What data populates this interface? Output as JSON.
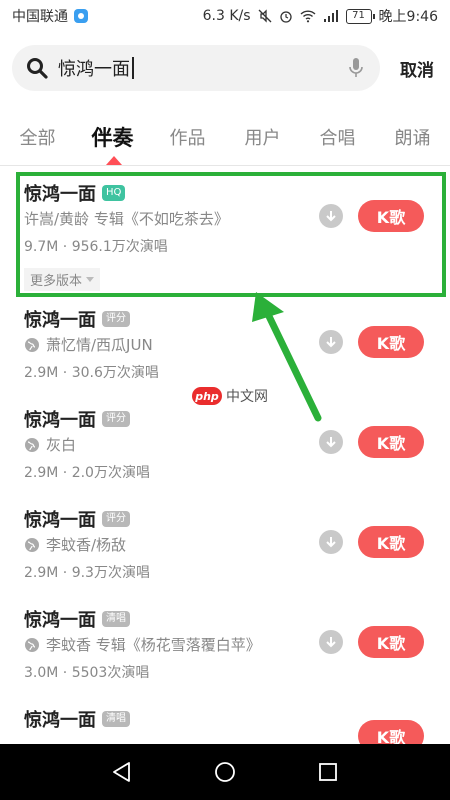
{
  "status_bar": {
    "carrier": "中国联通",
    "speed": "6.3 K/s",
    "battery": "71",
    "time": "晚上9:46"
  },
  "search": {
    "query": "惊鸿一面",
    "cancel_label": "取消"
  },
  "tabs": [
    {
      "label": "全部",
      "active": false
    },
    {
      "label": "伴奏",
      "active": true
    },
    {
      "label": "作品",
      "active": false
    },
    {
      "label": "用户",
      "active": false
    },
    {
      "label": "合唱",
      "active": false
    },
    {
      "label": "朗诵",
      "active": false
    }
  ],
  "results": [
    {
      "title": "惊鸿一面",
      "badge": "HQ",
      "subtitle": "许嵩/黄龄 专辑《不如吃茶去》",
      "meta": "9.7M · 956.1万次演唱",
      "more": "更多版本",
      "action": "K歌"
    },
    {
      "title": "惊鸿一面",
      "badge": "评分",
      "subtitle": "萧忆情/西瓜JUN",
      "meta": "2.9M · 30.6万次演唱",
      "action": "K歌"
    },
    {
      "title": "惊鸿一面",
      "badge": "评分",
      "subtitle": "灰白",
      "meta": "2.9M · 2.0万次演唱",
      "action": "K歌"
    },
    {
      "title": "惊鸿一面",
      "badge": "评分",
      "subtitle": "李蚊香/杨敌",
      "meta": "2.9M · 9.3万次演唱",
      "action": "K歌"
    },
    {
      "title": "惊鸿一面",
      "badge": "清唱",
      "subtitle": "李蚊香 专辑《杨花雪落覆白苹》",
      "meta": "3.0M · 5503次演唱",
      "action": "K歌"
    },
    {
      "title": "惊鸿一面",
      "badge": "清唱",
      "subtitle": "",
      "meta": "",
      "action": "K歌"
    }
  ],
  "watermark": {
    "logo": "php",
    "text": "中文网"
  },
  "colors": {
    "accent": "#f55a5a",
    "highlight": "#2bb039",
    "hq": "#3fc3a0"
  }
}
